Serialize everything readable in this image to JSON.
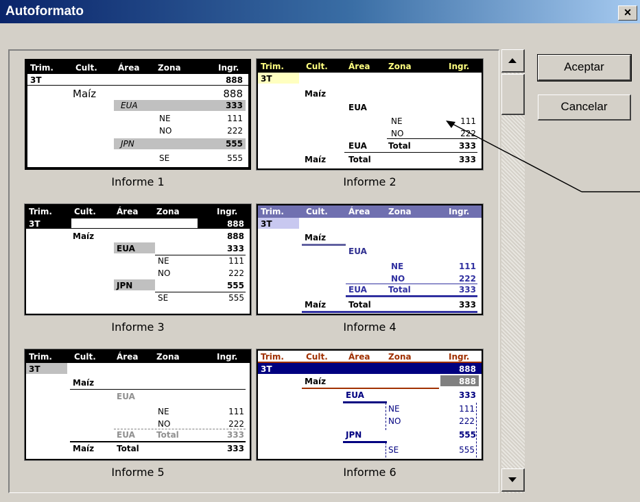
{
  "window": {
    "title": "Autoformato",
    "close_label": "×"
  },
  "buttons": {
    "accept": "Aceptar",
    "cancel": "Cancelar"
  },
  "formats": [
    {
      "caption": "Informe 1"
    },
    {
      "caption": "Informe 2"
    },
    {
      "caption": "Informe 3"
    },
    {
      "caption": "Informe 4"
    },
    {
      "caption": "Informe 5"
    },
    {
      "caption": "Informe 6"
    }
  ],
  "preview": {
    "headers": [
      "Trim.",
      "Cult.",
      "Área",
      "Zona",
      "Ingr."
    ],
    "quarter": "3T",
    "crop": "Maíz",
    "area1": "EUA",
    "area2": "JPN",
    "zone1": "NE",
    "zone2": "NO",
    "zone3": "SE",
    "total": "Total",
    "v888": "888",
    "v333": "333",
    "v111": "111",
    "v222": "222",
    "v555": "555"
  }
}
